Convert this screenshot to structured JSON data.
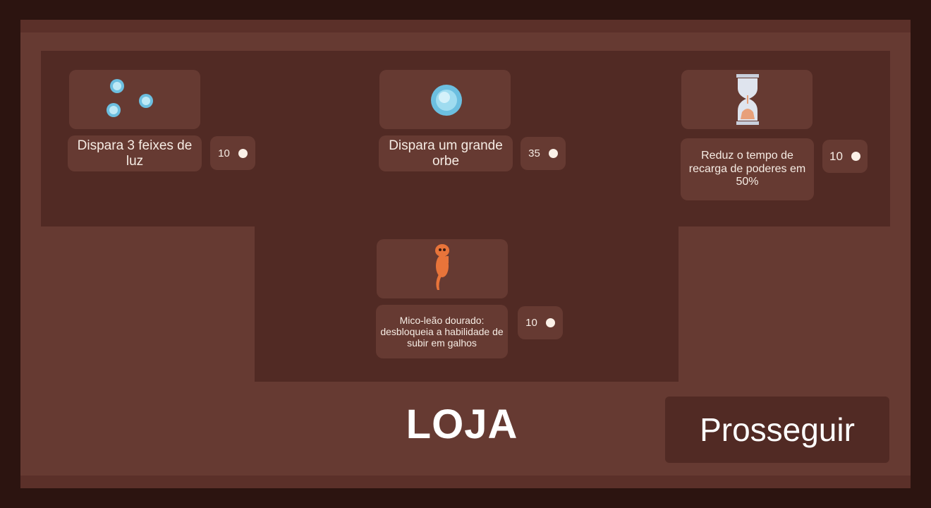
{
  "shop": {
    "title": "LOJA",
    "continue_label": "Prosseguir",
    "items": [
      {
        "icon": "three-light-beams-icon",
        "description": "Dispara 3 feixes de luz",
        "price": "10"
      },
      {
        "icon": "big-orb-icon",
        "description": "Dispara um grande orbe",
        "price": "35"
      },
      {
        "icon": "hourglass-icon",
        "description": "Reduz o tempo de recarga de poderes em 50%",
        "price": "10"
      },
      {
        "icon": "golden-lion-tamarin-icon",
        "description": "Mico-leão dourado: desbloqueia a habilidade de subir em galhos",
        "price": "10"
      }
    ]
  },
  "colors": {
    "background": "#2c1410",
    "frame": "#663a32",
    "panel": "#512a24",
    "orb": "#8fd3ea",
    "tamarin": "#e8743a",
    "coin": "#fbf1e8"
  }
}
